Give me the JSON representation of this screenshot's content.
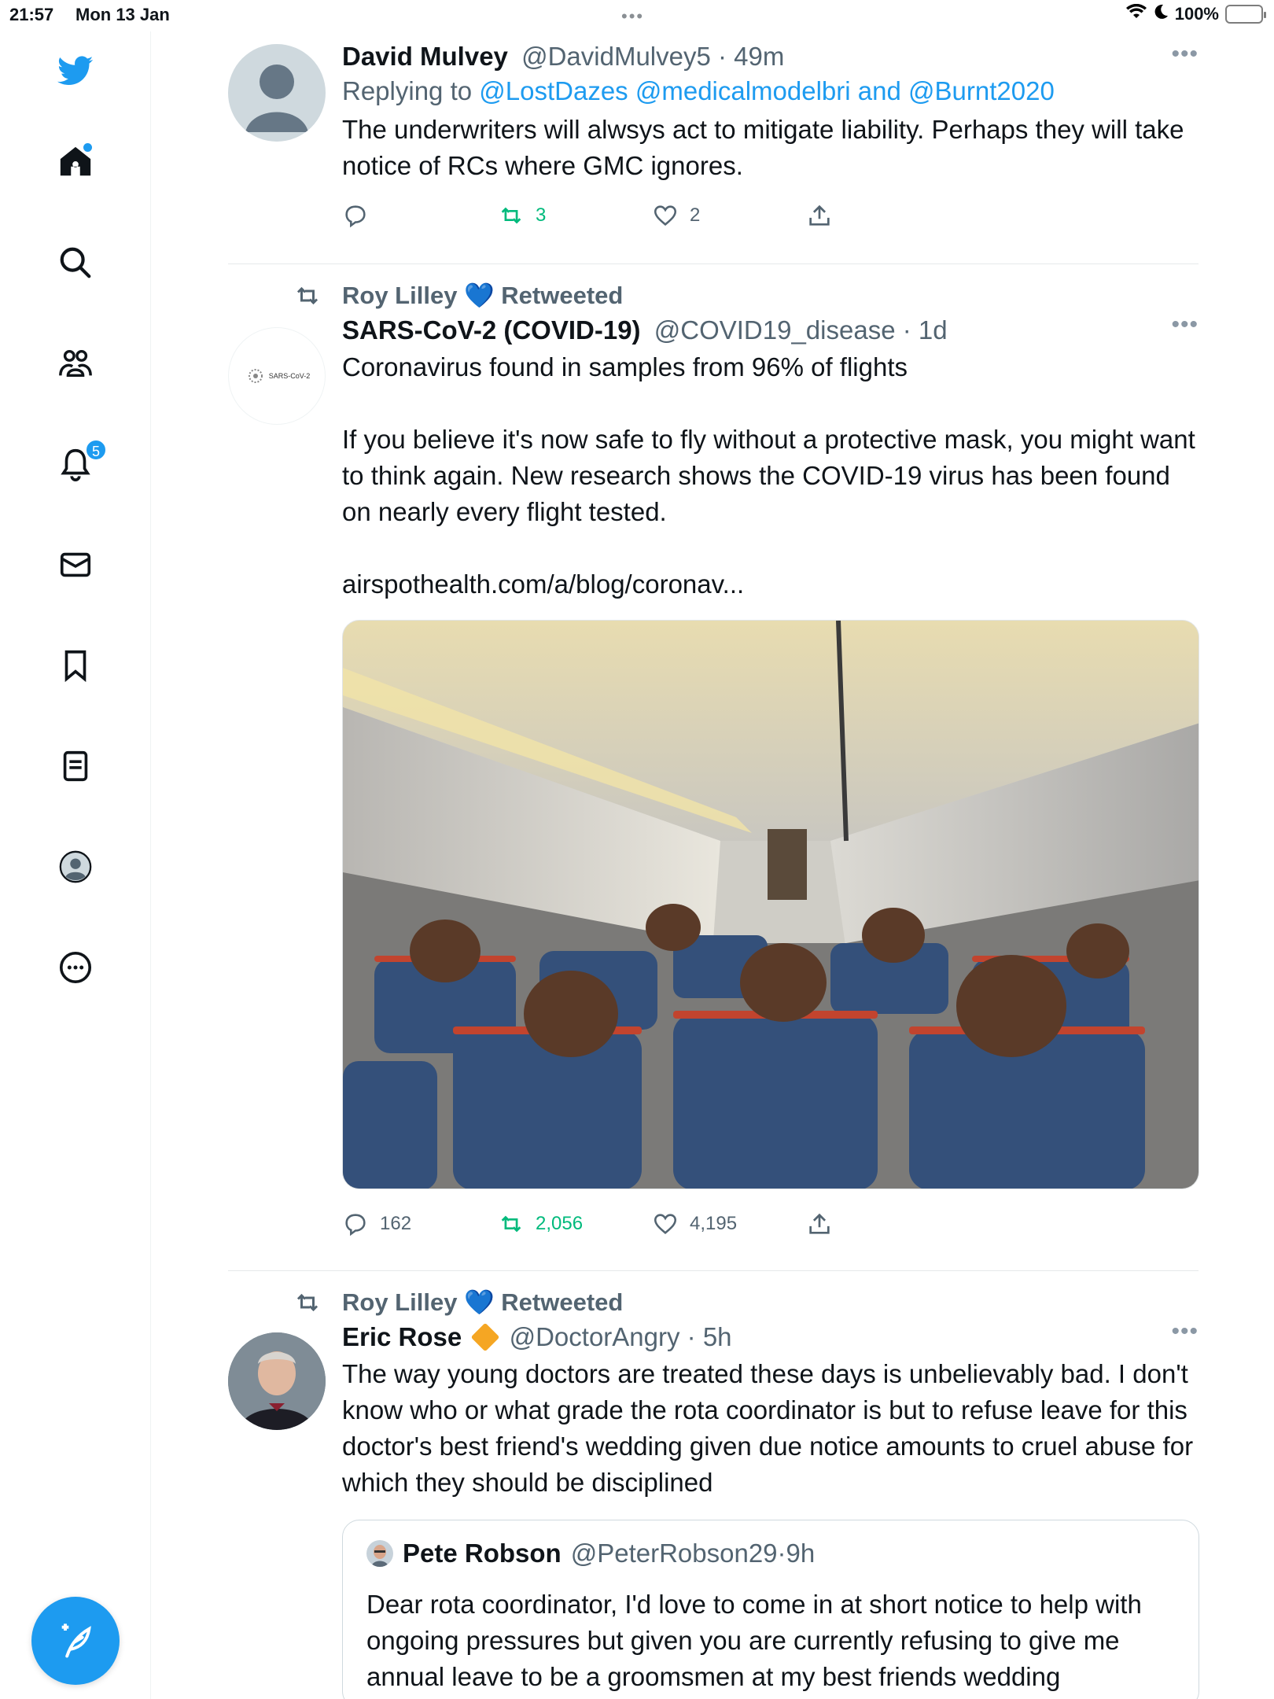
{
  "status_bar": {
    "time": "21:57",
    "date": "Mon 13 Jan",
    "battery": "100%"
  },
  "nav": {
    "notifications_badge": "5"
  },
  "tweets": [
    {
      "name": "David Mulvey",
      "handle": "@DavidMulvey5",
      "sep": " · ",
      "time": "49m",
      "reply_prefix": "Replying to ",
      "reply_mentions": "@LostDazes @medicalmodelbri",
      "reply_and": " and ",
      "reply_last": "@Burnt2020",
      "text": "The underwriters will alwsys act to mitigate liability. Perhaps they will take notice of RCs where GMC ignores.",
      "retweets": "3",
      "likes": "2"
    },
    {
      "retweeted_by": "Roy Lilley",
      "retweeted_label": "Retweeted",
      "name": "SARS-CoV-2 (COVID-19)",
      "handle": "@COVID19_disease",
      "sep": " · ",
      "time": "1d",
      "avatar_text": "SARS-CoV-2",
      "line1": "Coronavirus found in samples from 96% of flights",
      "line2": "If you believe it's now safe to fly without a protective mask, you might want to think again. New research shows the COVID-19 virus has been found on nearly every flight tested.",
      "link": "airspothealth.com/a/blog/coronav...",
      "replies": "162",
      "retweets": "2,056",
      "likes": "4,195"
    },
    {
      "retweeted_by": "Roy Lilley",
      "retweeted_label": "Retweeted",
      "name": "Eric Rose",
      "handle": "@DoctorAngry",
      "sep": " · ",
      "time": "5h",
      "text": "The way young doctors are treated these days is unbelievably bad. I don't know who or what grade the rota coordinator is  but to refuse leave for this doctor's best friend's wedding given due notice amounts to cruel abuse for which they should be disciplined",
      "quote": {
        "name": "Pete Robson",
        "handle": "@PeterRobson29",
        "sep": " · ",
        "time": "9h",
        "text": "Dear rota coordinator, I'd love to come in at short notice to help with ongoing pressures but given you are currently  refusing to give me annual leave to be a groomsmen at my best friends wedding"
      }
    }
  ],
  "colors": {
    "accent": "#1d9bf0",
    "retweet_green": "#00ba7c",
    "secondary_text": "#536471"
  }
}
